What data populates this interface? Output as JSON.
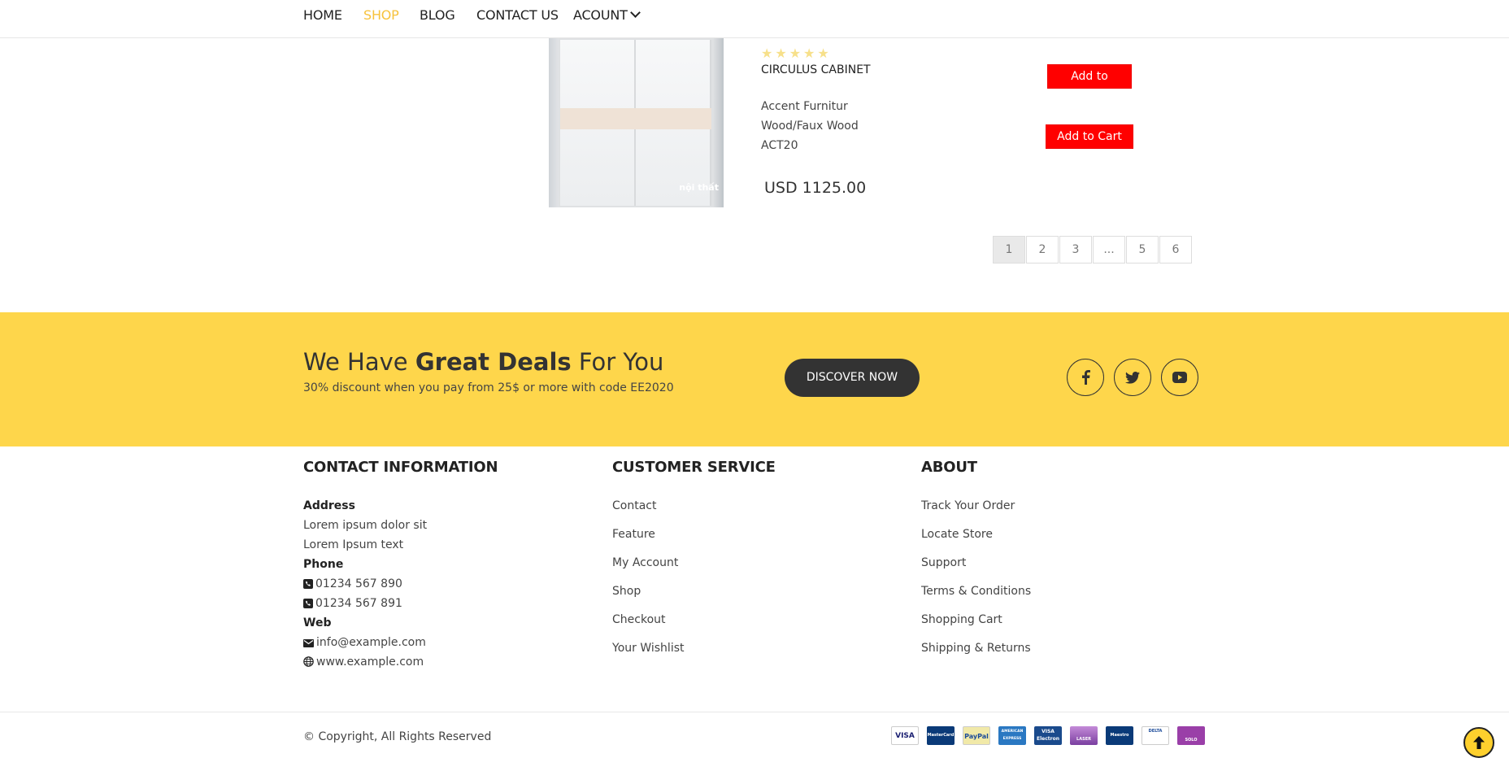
{
  "nav": {
    "items": [
      "HOME",
      "SHOP",
      "BLOG",
      "CONTACT US",
      "ACOUNT"
    ],
    "active": "SHOP"
  },
  "product": {
    "rating": 5,
    "rating_max": 5,
    "name": "CIRCULUS CABINET",
    "desc_lines": [
      "Accent Furnitur",
      "Wood/Faux Wood",
      "ACT20"
    ],
    "price": "USD 1125.00",
    "image_watermark": "nội thất",
    "wishlist_label": "Add to Wishlist",
    "cart_label": "Add to Cart"
  },
  "pagination": {
    "pages": [
      "1",
      "2",
      "3",
      "...",
      "5",
      "6"
    ],
    "current": "1"
  },
  "banner": {
    "title_pre": "We Have ",
    "title_bold": "Great Deals",
    "title_post": " For You",
    "subtitle": "30% discount when you pay from 25$ or more with code EE2020",
    "cta": "DISCOVER NOW",
    "social": [
      "facebook-icon",
      "twitter-icon",
      "youtube-icon"
    ]
  },
  "footer": {
    "contact": {
      "heading": "CONTACT INFORMATION",
      "address_label": "Address",
      "address_lines": [
        "Lorem ipsum dolor sit",
        "Lorem Ipsum text"
      ],
      "phone_label": "Phone",
      "phones": [
        "01234 567 890",
        "01234 567 891"
      ],
      "web_label": "Web",
      "email": "info@example.com",
      "website": "www.example.com"
    },
    "customer_service": {
      "heading": "CUSTOMER SERVICE",
      "links": [
        "Contact",
        "Feature",
        "My Account",
        "Shop",
        "Checkout",
        "Your Wishlist"
      ]
    },
    "about": {
      "heading": "ABOUT",
      "links": [
        "Track Your Order",
        "Locate Store",
        "Support",
        "Terms & Conditions",
        "Shopping Cart",
        "Shipping & Returns"
      ]
    },
    "copyright": "© Copyright, All Rights Reserved",
    "payment_cards": [
      "VISA",
      "MasterCard",
      "PayPal",
      "AMERICAN EXPRESS",
      "VISA Electron",
      "LASER",
      "Maestro",
      "DELTA",
      "SOLO"
    ]
  },
  "colors": {
    "accent": "#fed64b",
    "nav_active": "#f7c23c",
    "button_red": "#ff0000",
    "dark": "#333333"
  }
}
